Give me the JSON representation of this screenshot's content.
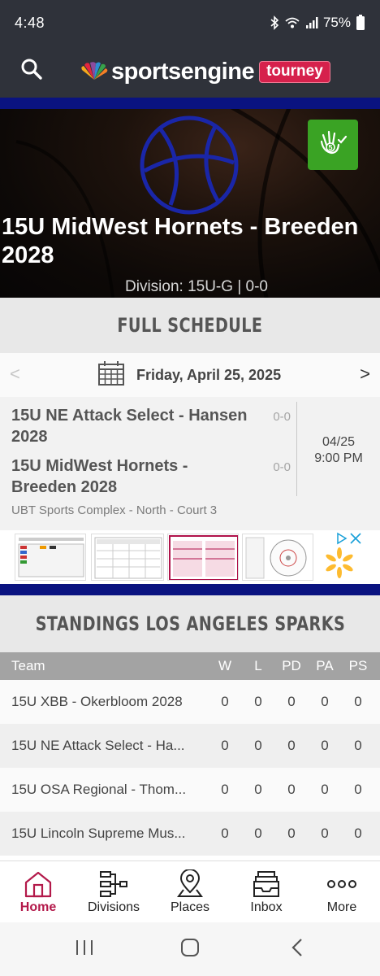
{
  "status_bar": {
    "time": "4:48",
    "battery": "75%"
  },
  "header": {
    "brand_name": "sportsengine",
    "brand_badge": "tourney",
    "search_icon": "search-icon"
  },
  "hero": {
    "title": "15U MidWest Hornets - Breeden 2028",
    "division": "Division: 15U-G | 0-0",
    "badge_icon": "hand-check-icon"
  },
  "schedule": {
    "heading": "FULL SCHEDULE",
    "prev": "<",
    "next": ">",
    "date": "Friday, April 25, 2025",
    "game": {
      "team1": "15U NE Attack Select - Hansen 2028",
      "team1_score": "0-0",
      "team2": "15U MidWest Hornets - Breeden 2028",
      "team2_score": "0-0",
      "date": "04/25",
      "time": "9:00 PM",
      "location": "UBT Sports Complex - North - Court 3"
    }
  },
  "standings": {
    "heading": "STANDINGS LOS ANGELES SPARKS",
    "columns": [
      "Team",
      "W",
      "L",
      "PD",
      "PA",
      "PS"
    ],
    "rows": [
      {
        "team": "15U XBB - Okerbloom 2028",
        "w": "0",
        "l": "0",
        "pd": "0",
        "pa": "0",
        "ps": "0"
      },
      {
        "team": "15U NE Attack Select - Ha...",
        "w": "0",
        "l": "0",
        "pd": "0",
        "pa": "0",
        "ps": "0"
      },
      {
        "team": "15U OSA Regional - Thom...",
        "w": "0",
        "l": "0",
        "pd": "0",
        "pa": "0",
        "ps": "0"
      },
      {
        "team": "15U Lincoln Supreme Mus...",
        "w": "0",
        "l": "0",
        "pd": "0",
        "pa": "0",
        "ps": "0"
      }
    ]
  },
  "nav": {
    "items": [
      {
        "label": "Home",
        "icon": "home-icon",
        "active": true
      },
      {
        "label": "Divisions",
        "icon": "bracket-icon",
        "active": false
      },
      {
        "label": "Places",
        "icon": "map-pin-icon",
        "active": false
      },
      {
        "label": "Inbox",
        "icon": "inbox-icon",
        "active": false
      },
      {
        "label": "More",
        "icon": "more-icon",
        "active": false
      }
    ]
  },
  "colors": {
    "header_bg": "#2f323a",
    "accent_blue": "#0a1380",
    "brand_red": "#d6214c",
    "active_nav": "#b3194a",
    "badge_green": "#3aa324"
  }
}
